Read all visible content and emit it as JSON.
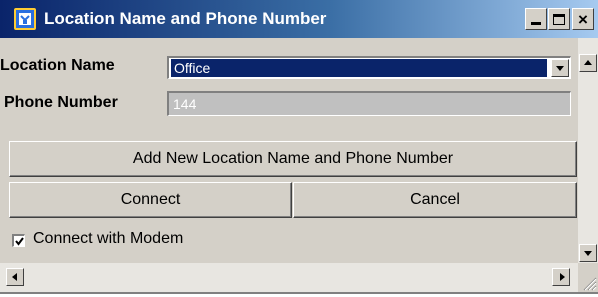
{
  "window": {
    "title": "Location Name and Phone Number",
    "icon": "app-icon",
    "controls": {
      "minimize": "minimize-icon",
      "maximize": "maximize-icon",
      "close": "×"
    }
  },
  "form": {
    "location_label": "Location Name",
    "location_value": "Office",
    "phone_label": "Phone Number",
    "phone_value": "144"
  },
  "buttons": {
    "add_label": "Add New Location Name and Phone Number",
    "connect_label": "Connect",
    "cancel_label": "Cancel"
  },
  "modem": {
    "label": "Connect with Modem",
    "checked": true
  },
  "colors": {
    "titlebar_start": "#0a246a",
    "titlebar_end": "#a6caf0",
    "selection": "#0a246a",
    "face": "#d4d0c8"
  }
}
